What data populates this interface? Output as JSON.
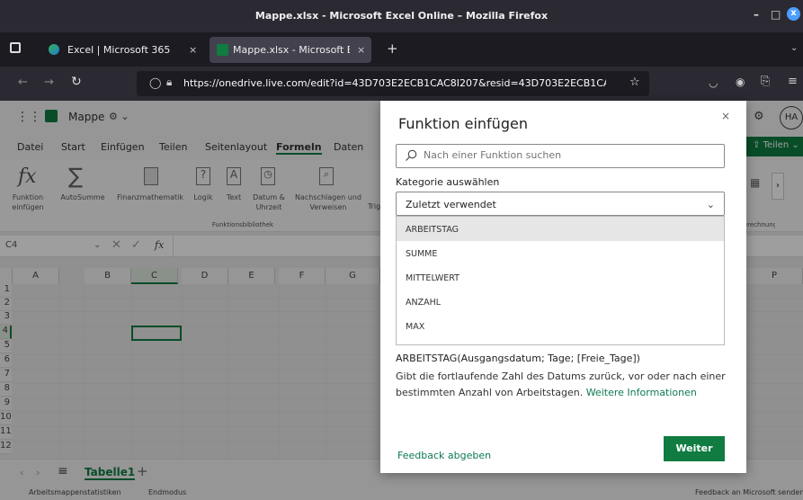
{
  "window": {
    "title": "Mappe.xlsx - Microsoft Excel Online – Mozilla Firefox",
    "minimize": "–",
    "maximize": "□",
    "close": "x"
  },
  "tabs": [
    {
      "label": "Excel | Microsoft 365",
      "close": "×"
    },
    {
      "label": "Mappe.xlsx - Microsoft Exc",
      "close": "×"
    }
  ],
  "new_tab": "+",
  "url": "https://onedrive.live.com/edit?id=43D703E2ECB1CAC8I207&resid=43D703E2ECB1CAC8I20",
  "excel": {
    "app_name": "Mappe",
    "menu": [
      "Datei",
      "Start",
      "Einfügen",
      "Teilen",
      "Seitenlayout",
      "Formeln",
      "Daten"
    ],
    "active_menu": "Formeln",
    "share": "Teilen",
    "avatar": "HA",
    "ribbon": [
      {
        "label": "Funktion\neinfügen"
      },
      {
        "label": "AutoSumme"
      },
      {
        "label": "Finanzmathematik"
      },
      {
        "label": "Logik"
      },
      {
        "label": "Text"
      },
      {
        "label": "Datum &\nUhrzeit"
      },
      {
        "label": "Nachschlagen und\nVerweisen"
      },
      {
        "label": "Trig"
      }
    ],
    "group_label": "Funktionsbibliothek",
    "ribbon_right": "Berechnung",
    "namebox": "C4",
    "fx": "fx",
    "columns": [
      "A",
      "B",
      "C",
      "D",
      "E",
      "F",
      "G",
      "P"
    ],
    "rows": [
      "1",
      "2",
      "3",
      "4",
      "5",
      "6",
      "7",
      "8",
      "9",
      "10",
      "11",
      "12"
    ],
    "sheet_tab": "Tabelle1",
    "add_sheet": "+",
    "status_left": "Arbeitsmappenstatistiken",
    "status_mode": "Endmodus",
    "status_right": "Feedback an Microsoft senden"
  },
  "dialog": {
    "title": "Funktion einfügen",
    "close": "×",
    "search_placeholder": "Nach einer Funktion suchen",
    "category_label": "Kategorie auswählen",
    "category_value": "Zuletzt verwendet",
    "functions": [
      "ARBEITSTAG",
      "SUMME",
      "MITTELWERT",
      "ANZAHL",
      "MAX"
    ],
    "signature": "ARBEITSTAG(Ausgangsdatum; Tage; [Freie_Tage])",
    "description": "Gibt die fortlaufende Zahl des Datums zurück, vor oder nach einer bestimmten Anzahl von Arbeitstagen.",
    "more_info": "Weitere Informationen",
    "feedback": "Feedback abgeben",
    "ok": "Weiter"
  },
  "colors": {
    "accent": "#107c41",
    "link": "#0e7a4f"
  }
}
